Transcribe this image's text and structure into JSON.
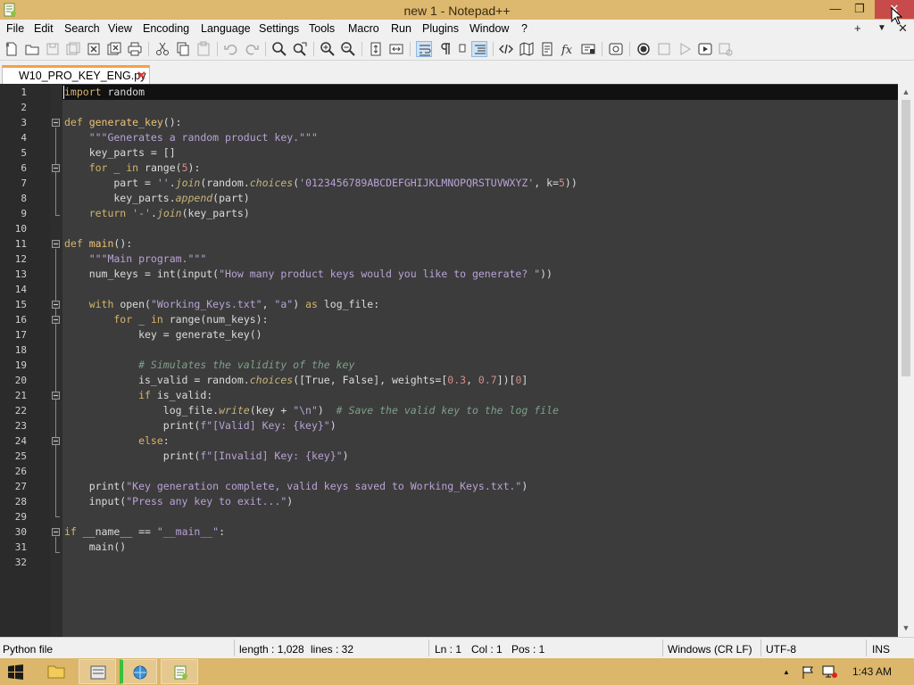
{
  "window": {
    "title": "new 1 - Notepad++",
    "minimize": "—",
    "maximize": "❐",
    "close": "✕"
  },
  "menu": {
    "items": [
      "File",
      "Edit",
      "Search",
      "View",
      "Encoding",
      "Language",
      "Settings",
      "Tools",
      "Macro",
      "Run",
      "Plugins",
      "Window",
      "?"
    ],
    "right_plus": "+",
    "right_down": "▼",
    "right_close": "✕"
  },
  "toolbar": {
    "icons": [
      "new-file-icon",
      "open-file-icon",
      "save-icon",
      "save-all-icon",
      "close-icon",
      "close-all-icon",
      "print-icon",
      "cut-icon",
      "copy-icon",
      "paste-icon",
      "undo-icon",
      "redo-icon",
      "find-icon",
      "replace-icon",
      "zoom-in-icon",
      "zoom-out-icon",
      "sync-vertical-icon",
      "sync-horizontal-icon",
      "word-wrap-icon",
      "show-all-chars-icon",
      "indent-guide-icon",
      "document-map-icon",
      "xml-tag-icon",
      "map-icon",
      "document-list-icon",
      "function-list-icon",
      "folder-workspace-icon",
      "monitoring-icon",
      "record-macro-icon",
      "stop-macro-icon",
      "play-macro-icon",
      "run-macro-multiple-icon",
      "save-macro-icon"
    ]
  },
  "tab": {
    "label": "W10_PRO_KEY_ENG.py",
    "close": "✕"
  },
  "editor": {
    "line_numbers": [
      "1",
      "2",
      "3",
      "4",
      "5",
      "6",
      "7",
      "8",
      "9",
      "10",
      "11",
      "12",
      "13",
      "14",
      "15",
      "16",
      "17",
      "18",
      "19",
      "20",
      "21",
      "22",
      "23",
      "24",
      "25",
      "26",
      "27",
      "28",
      "29",
      "30",
      "31",
      "32"
    ],
    "tokens": {
      "l1_kw": "import",
      "l1_rest": " random",
      "l3_kw": "def",
      "l3_fn": " generate_key",
      "l3_rest": "():",
      "l4_str": "    \"\"\"Generates a random product key.\"\"\"",
      "l5": "    key_parts = []",
      "l6_kw": "    for",
      "l6_mid": " _ ",
      "l6_kw2": "in",
      "l6_mid2": " range(",
      "l6_num": "5",
      "l6_end": "):",
      "l7_a": "        part = ",
      "l7_str1": "''",
      "l7_dot": ".",
      "l7_meth": "join",
      "l7_b": "(random.",
      "l7_meth2": "choices",
      "l7_c": "(",
      "l7_str2": "'0123456789ABCDEFGHIJKLMNOPQRSTUVWXYZ'",
      "l7_d": ", k=",
      "l7_num": "5",
      "l7_e": "))",
      "l8_a": "        key_parts.",
      "l8_meth": "append",
      "l8_b": "(part)",
      "l9_kw": "    return",
      "l9_str": " '-'",
      "l9_dot": ".",
      "l9_meth": "join",
      "l9_b": "(key_parts)",
      "l11_kw": "def",
      "l11_fn": " main",
      "l11_rest": "():",
      "l12_str": "    \"\"\"Main program.\"\"\"",
      "l13_a": "    num_keys = int(input(",
      "l13_str": "\"How many product keys would you like to generate? \"",
      "l13_b": "))",
      "l15_kw": "    with",
      "l15_a": " open(",
      "l15_str1": "\"Working_Keys.txt\"",
      "l15_b": ", ",
      "l15_str2": "\"a\"",
      "l15_c": ") ",
      "l15_kw2": "as",
      "l15_d": " log_file:",
      "l16_kw": "        for",
      "l16_mid": " _ ",
      "l16_kw2": "in",
      "l16_rest": " range(num_keys):",
      "l17": "            key = generate_key()",
      "l19_cmt": "            # Simulates the validity of the key",
      "l20_a": "            is_valid = random.",
      "l20_meth": "choices",
      "l20_b": "([True, False], weights=[",
      "l20_num1": "0.3",
      "l20_c": ", ",
      "l20_num2": "0.7",
      "l20_d": "])[",
      "l20_num3": "0",
      "l20_e": "]",
      "l21_kw": "            if",
      "l21_rest": " is_valid:",
      "l22_a": "                log_file.",
      "l22_meth": "write",
      "l22_b": "(key + ",
      "l22_str": "\"\\n\"",
      "l22_c": ")  ",
      "l22_cmt": "# Save the valid key to the log file",
      "l23_a": "                print(",
      "l23_str": "f\"[Valid] Key: {key}\"",
      "l23_b": ")",
      "l24_kw": "            else",
      "l24_rest": ":",
      "l25_a": "                print(",
      "l25_str": "f\"[Invalid] Key: {key}\"",
      "l25_b": ")",
      "l27_a": "    print(",
      "l27_str": "\"Key generation complete, valid keys saved to Working_Keys.txt.\"",
      "l27_b": ")",
      "l28_a": "    input(",
      "l28_str": "\"Press any key to exit...\"",
      "l28_b": ")",
      "l30_kw": "if",
      "l30_a": " __name__ == ",
      "l30_str": "\"__main__\"",
      "l30_b": ":",
      "l31": "    main()"
    }
  },
  "status": {
    "file_type": "Python file",
    "length": "length : 1,028",
    "lines": "lines : 32",
    "ln": "Ln : 1",
    "col": "Col : 1",
    "pos": "Pos : 1",
    "eol": "Windows (CR LF)",
    "encoding": "UTF-8",
    "mode": "INS"
  },
  "taskbar": {
    "clock": "1:43 AM",
    "tray_up": "▲"
  },
  "colors": {
    "titlebar": "#ddb86f",
    "editor_bg": "#3c3c3c",
    "keyword": "#d6b46a",
    "string": "#b9a3d6",
    "number": "#d48c8c",
    "comment": "#7fa08a",
    "tab_accent": "#f2a245",
    "close_button": "#c74b4b"
  }
}
